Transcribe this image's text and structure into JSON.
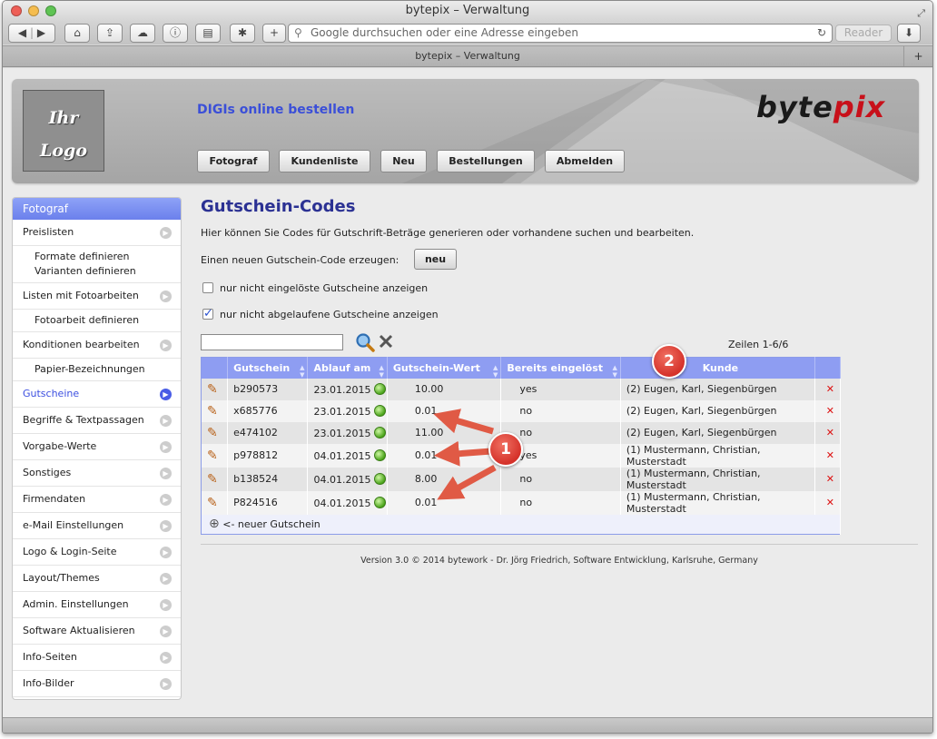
{
  "browser": {
    "window_title": "bytepix – Verwaltung",
    "tab_title": "bytepix – Verwaltung",
    "url_placeholder": "Google durchsuchen oder eine Adresse eingeben",
    "reader_label": "Reader",
    "new_tab_label": "+"
  },
  "header": {
    "logo_line1": "Ihr",
    "logo_line2": "Logo",
    "slogan": "DIGIs online bestellen",
    "brand_a": "byte",
    "brand_b": "pix",
    "nav": [
      "Fotograf",
      "Kundenliste",
      "Neu",
      "Bestellungen",
      "Abmelden"
    ]
  },
  "sidebar": {
    "title": "Fotograf",
    "items": [
      {
        "label": "Preislisten",
        "type": "item"
      },
      {
        "label": "Formate definieren",
        "label2": "Varianten definieren",
        "type": "sub2"
      },
      {
        "label": "Listen mit Fotoarbeiten",
        "type": "item"
      },
      {
        "label": "Fotoarbeit definieren",
        "type": "sub"
      },
      {
        "label": "Konditionen bearbeiten",
        "type": "item"
      },
      {
        "label": "Papier-Bezeichnungen",
        "type": "sub"
      },
      {
        "label": "Gutscheine",
        "type": "item",
        "active": true
      },
      {
        "label": "Begriffe & Textpassagen",
        "type": "item"
      },
      {
        "label": "Vorgabe-Werte",
        "type": "item"
      },
      {
        "label": "Sonstiges",
        "type": "item"
      },
      {
        "label": "Firmendaten",
        "type": "item"
      },
      {
        "label": "e-Mail Einstellungen",
        "type": "item"
      },
      {
        "label": "Logo & Login-Seite",
        "type": "item"
      },
      {
        "label": "Layout/Themes",
        "type": "item"
      },
      {
        "label": "Admin. Einstellungen",
        "type": "item"
      },
      {
        "label": "Software Aktualisieren",
        "type": "item"
      },
      {
        "label": "Info-Seiten",
        "type": "item"
      },
      {
        "label": "Info-Bilder",
        "type": "item"
      }
    ]
  },
  "main": {
    "title": "Gutschein-Codes",
    "intro": "Hier können Sie Codes für Gutschrift-Beträge generieren oder vorhandene suchen und bearbeiten.",
    "new_label": "Einen neuen Gutschein-Code erzeugen:",
    "new_button": "neu",
    "filter1": {
      "label": "nur nicht eingelöste Gutscheine anzeigen",
      "checked": false
    },
    "filter2": {
      "label": "nur nicht abgelaufene Gutscheine anzeigen",
      "checked": true
    },
    "search_value": "",
    "rows_info": "Zeilen 1-6/6",
    "columns": [
      "Gutschein",
      "Ablauf am",
      "Gutschein-Wert",
      "Bereits eingelöst",
      "Kunde"
    ],
    "rows": [
      {
        "code": "b290573",
        "expiry": "23.01.2015",
        "value": "10.00",
        "redeemed": "yes",
        "customer": "(2) Eugen, Karl, Siegenbürgen"
      },
      {
        "code": "x685776",
        "expiry": "23.01.2015",
        "value": "0.01",
        "redeemed": "no",
        "customer": "(2) Eugen, Karl, Siegenbürgen"
      },
      {
        "code": "e474102",
        "expiry": "23.01.2015",
        "value": "11.00",
        "redeemed": "no",
        "customer": "(2) Eugen, Karl, Siegenbürgen"
      },
      {
        "code": "p978812",
        "expiry": "04.01.2015",
        "value": "0.01",
        "redeemed": "yes",
        "customer": "(1) Mustermann, Christian, Musterstadt"
      },
      {
        "code": "b138524",
        "expiry": "04.01.2015",
        "value": "8.00",
        "redeemed": "no",
        "customer": "(1) Mustermann, Christian, Musterstadt"
      },
      {
        "code": "P824516",
        "expiry": "04.01.2015",
        "value": "0.01",
        "redeemed": "no",
        "customer": "(1) Mustermann, Christian, Musterstadt"
      }
    ],
    "add_label": "<- neuer Gutschein",
    "version": "Version 3.0 © 2014 bytework - Dr. Jörg Friedrich, Software Entwicklung, Karlsruhe, Germany"
  },
  "callouts": {
    "one": "1",
    "two": "2"
  },
  "colors": {
    "accent": "#3b4fd8",
    "table_header": "#8e9df2",
    "callout": "#d5322a",
    "title": "#2b3193"
  }
}
